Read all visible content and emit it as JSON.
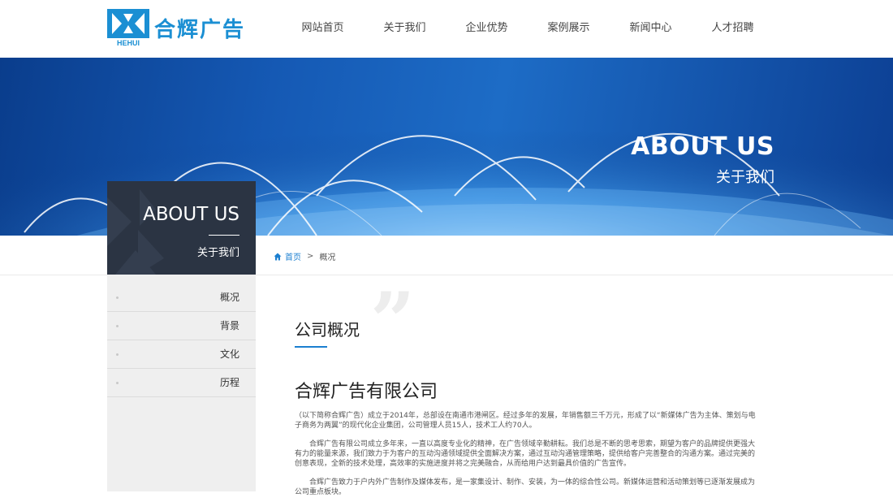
{
  "header": {
    "logo": {
      "mark_text": "HEHUI",
      "name": "合辉广告",
      "brand_color": "#1b8fd3"
    },
    "nav": [
      {
        "label": "网站首页"
      },
      {
        "label": "关于我们"
      },
      {
        "label": "企业优势"
      },
      {
        "label": "案例展示"
      },
      {
        "label": "新闻中心"
      },
      {
        "label": "人才招聘"
      }
    ]
  },
  "banner": {
    "title_en": "ABOUT US",
    "title_cn": "关于我们"
  },
  "sidebar": {
    "title_en": "ABOUT US",
    "title_cn": "关于我们",
    "items": [
      {
        "label": "概况"
      },
      {
        "label": "背景"
      },
      {
        "label": "文化"
      },
      {
        "label": "历程"
      }
    ]
  },
  "breadcrumb": {
    "home": "首页",
    "separator": ">",
    "current": "概况",
    "home_icon": "home-icon"
  },
  "content": {
    "quote_mark": "”",
    "section_title": "公司概况",
    "company_name": "合辉广告有限公司",
    "paragraphs": [
      "（以下简称合辉广告）成立于2014年，总部设在南通市港闸区。经过多年的发展，年销售额三千万元，形成了以“新媒体广告为主体、策划与电子商务为两翼”的现代化企业集团，公司管理人员15人，技术工人约70人。",
      "　　合辉广告有限公司成立多年来，一直以高度专业化的精神，在广告领域辛勤耕耘。我们总是不断的思考思索，期望为客户的品牌提供更强大有力的能量来源，我们致力于为客户的互动沟通领域提供全面解决方案，通过互动沟通管理策略，提供给客户完善整合的沟通方案。通过完美的创意表现，全新的技术处理，高效率的实施进度并将之完美融合，从而给用户达到最具价值的广告宣传。",
      "　　合辉广告致力于户内外广告制作及媒体发布，是一家集设计、制作、安装，为一体的综合性公司。新媒体运营和活动策划等已逐渐发展成为公司重点板块。"
    ]
  },
  "colors": {
    "accent": "#1b7fd0",
    "sidebar_head": "#2b3443",
    "sidebar_menu": "#efefef"
  }
}
